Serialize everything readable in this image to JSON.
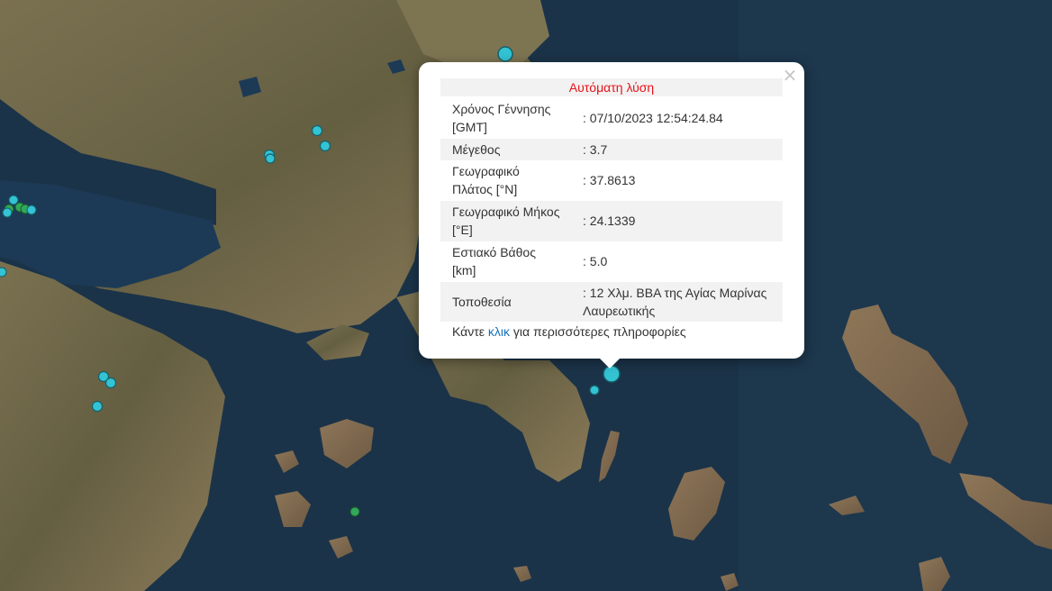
{
  "popup": {
    "title": "Αυτόματη λύση",
    "close_icon": "×",
    "rows": [
      {
        "label": "Χρόνος Γέννησης [GMT]",
        "value": ": 07/10/2023 12:54:24.84"
      },
      {
        "label": "Μέγεθος",
        "value": ": 3.7"
      },
      {
        "label": "Γεωγραφικό Πλάτος [°N]",
        "value": ": 37.8613"
      },
      {
        "label": "Γεωγραφικό Μήκος [°E]",
        "value": ": 24.1339"
      },
      {
        "label": "Εστιακό Βάθος [km]",
        "value": ": 5.0"
      },
      {
        "label": "Τοποθεσία",
        "value": ": 12 Χλμ. ΒΒΑ της Αγίας Μαρίνας Λαυρεωτικής"
      }
    ],
    "footer_prefix": "Κάντε ",
    "footer_link": "κλικ",
    "footer_suffix": " για περισσότερες πληροφορίες"
  },
  "colors": {
    "sea": "#1b3348",
    "land": "#6f6a4c",
    "marker_cyan": "#33c3d3",
    "marker_green": "#33a85a",
    "title_red": "#e8121a",
    "link_blue": "#1a73b8"
  }
}
